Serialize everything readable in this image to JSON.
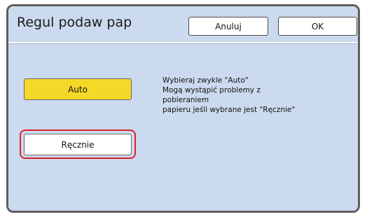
{
  "dialog": {
    "title": "Regul podaw pap",
    "cancel_label": "Anuluj",
    "ok_label": "OK"
  },
  "options": {
    "auto_label": "Auto",
    "manual_label": "Ręcznie",
    "selected": "Ręcznie"
  },
  "description": {
    "line1": "Wybieraj zwykle \"Auto\"",
    "line2": "Mogą wystąpić problemy z",
    "line3": "pobieraniem",
    "line4": "papieru jeśli wybrane jest \"Ręcznie\""
  },
  "colors": {
    "panel_bg": "#ccdaef",
    "auto_button": "#f5d928",
    "selection_ring": "#d8232a"
  }
}
